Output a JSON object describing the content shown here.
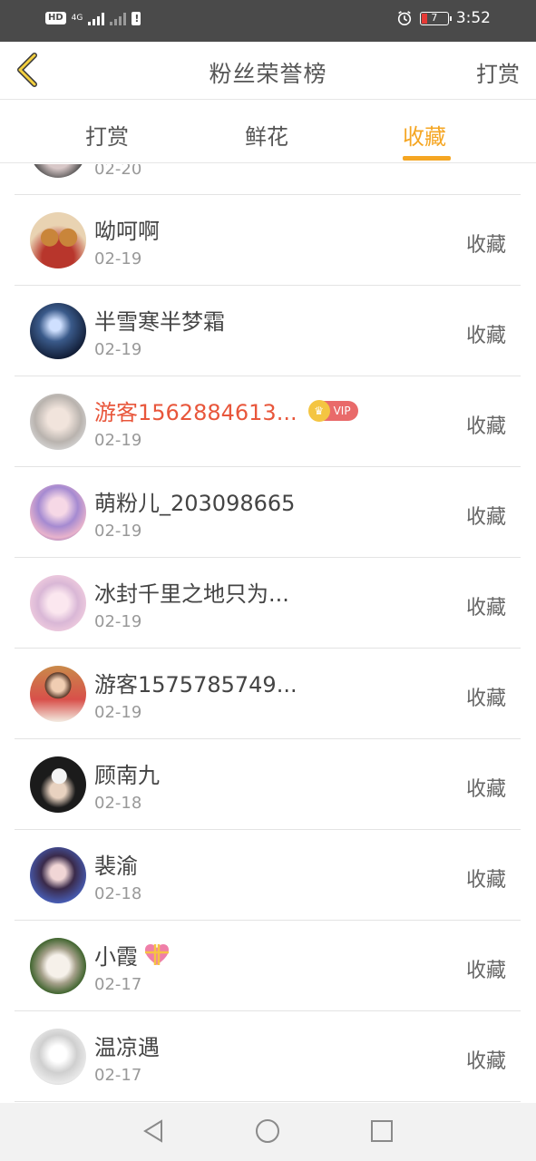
{
  "status_bar": {
    "network": "4G",
    "hd": "HD",
    "time": "3:52",
    "battery": "7"
  },
  "header": {
    "title": "粉丝荣誉榜",
    "action": "打赏"
  },
  "tabs": [
    {
      "label": "打赏"
    },
    {
      "label": "鲜花"
    },
    {
      "label": "收藏",
      "active": true
    }
  ],
  "list": {
    "partial_date": "02-20",
    "items": [
      {
        "name": "呦呵啊",
        "date": "02-19",
        "action": "收藏"
      },
      {
        "name": "半雪寒半梦霜",
        "date": "02-19",
        "action": "收藏"
      },
      {
        "name": "游客1562884613...",
        "date": "02-19",
        "action": "收藏",
        "vip": "VIP"
      },
      {
        "name": "萌粉儿_203098665",
        "date": "02-19",
        "action": "收藏"
      },
      {
        "name": "冰封千里之地只为...",
        "date": "02-19",
        "action": "收藏"
      },
      {
        "name": "游客1575785749...",
        "date": "02-19",
        "action": "收藏"
      },
      {
        "name": "顾南九",
        "date": "02-18",
        "action": "收藏"
      },
      {
        "name": "裴渝",
        "date": "02-18",
        "action": "收藏"
      },
      {
        "name": "小霞",
        "date": "02-17",
        "action": "收藏"
      },
      {
        "name": "温凉遇",
        "date": "02-17",
        "action": "收藏"
      }
    ]
  },
  "colors": {
    "accent": "#f5a623",
    "vip_name": "#e8563b",
    "status_bar": "#4a4a4a"
  },
  "icons": [
    "back-chevron-icon",
    "alarm-icon",
    "battery-icon",
    "signal-icon",
    "heart-gift-icon",
    "vip-crown-icon",
    "nav-back-icon",
    "nav-home-icon",
    "nav-recents-icon"
  ]
}
